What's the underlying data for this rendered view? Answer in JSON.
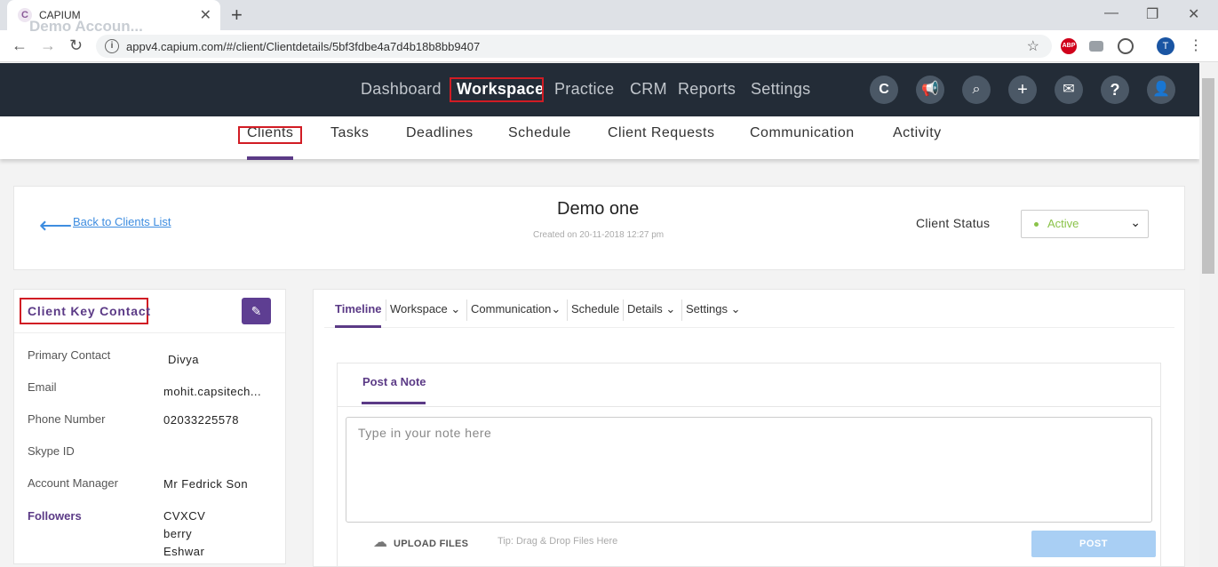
{
  "browser": {
    "tab_title": "CAPIUM",
    "url": "appv4.capium.com/#/client/Clientdetails/5bf3fdbe4a7d4b18b8bb9407",
    "profile_initial": "T",
    "ext_abp": "ABP"
  },
  "app": {
    "account": "Demo Accoun...",
    "main_nav": [
      "Dashboard",
      "Workspace",
      "Practice",
      "CRM",
      "Reports",
      "Settings"
    ],
    "active_main": "Workspace",
    "sub_nav": [
      "Clients",
      "Tasks",
      "Deadlines",
      "Schedule",
      "Client Requests",
      "Communication",
      "Activity"
    ],
    "active_sub": "Clients"
  },
  "client": {
    "back_label": "Back to Clients List",
    "name": "Demo one",
    "created": "Created on 20-11-2018 12:27 pm",
    "status_label": "Client Status",
    "status_value": "Active"
  },
  "key_contact": {
    "title": "Client Key Contact",
    "fields": [
      {
        "label": "Primary Contact",
        "value": "Divya"
      },
      {
        "label": "Email",
        "value": "mohit.capsitech..."
      },
      {
        "label": "Phone Number",
        "value": "02033225578"
      },
      {
        "label": "Skype ID",
        "value": ""
      },
      {
        "label": "Account Manager",
        "value": "Mr Fedrick Son"
      },
      {
        "label": "Followers",
        "value": "CVXCV"
      }
    ],
    "followers": [
      "CVXCV",
      "berry",
      "Eshwar"
    ]
  },
  "timeline": {
    "tabs": [
      "Timeline",
      "Workspace",
      "Communication",
      "Schedule",
      "Details",
      "Settings"
    ],
    "active_tab": "Timeline",
    "post_tab": "Post a Note",
    "note_placeholder": "Type in your note here",
    "upload_label": "UPLOAD FILES",
    "tip": "Tip: Drag & Drop Files Here",
    "post_button": "POST"
  },
  "colors": {
    "header_bg": "#232c37",
    "accent": "#5b3a86",
    "link": "#3e8de0",
    "active_status": "#8bc34a",
    "highlight_box": "#d11c24"
  }
}
